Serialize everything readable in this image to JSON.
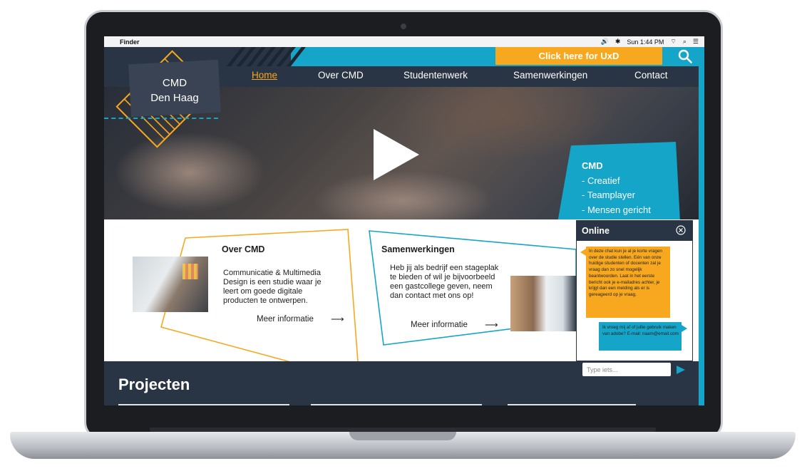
{
  "menubar": {
    "app": "Finder",
    "clock": "Sun 1:44 PM"
  },
  "header": {
    "uxd_button": "Click here for UxD",
    "search_icon": "search-icon"
  },
  "nav": {
    "items": [
      "Home",
      "Over CMD",
      "Studentenwerk",
      "Samenwerkingen",
      "Contact"
    ],
    "active": "Home"
  },
  "logo": {
    "line1": "CMD",
    "line2": "Den Haag"
  },
  "hero": {
    "play_icon": "play-icon",
    "card_title": "CMD",
    "card_items": [
      "- Creatief",
      "- Teamplayer",
      "- Mensen gericht"
    ]
  },
  "cards": {
    "over": {
      "title": "Over CMD",
      "body": "Communicatie & Multimedia Design is een studie waar je leert om goede digitale producten te ontwerpen.",
      "link": "Meer informatie"
    },
    "samen": {
      "title": "Samenwerkingen",
      "body": "Heb jij als bedrijf een stageplak te bieden of wil je bijvoorbeeld een gastcollege geven, neem dan contact met ons op!",
      "link": "Meer informatie"
    }
  },
  "projects": {
    "title": "Projecten"
  },
  "chat": {
    "title": "Online",
    "incoming": "In deze chat kun je al je korte vragen over de studie stellen. Eén van onze huidige studenten of docenten zal je vraag dan zo snel mogelijk beantwoorden. Laat in het eerste bericht ook je e-mailadres achter, je krijgt dan een melding als er is gereageerd op je vraag.",
    "outgoing": "Ik vroeg mij af of jullie gebruik maken van adobe? E-mail: naam@email.com",
    "input_placeholder": "Type iets..."
  },
  "colors": {
    "navy": "#293445",
    "cyan": "#14a5c9",
    "orange": "#f7a81e"
  }
}
